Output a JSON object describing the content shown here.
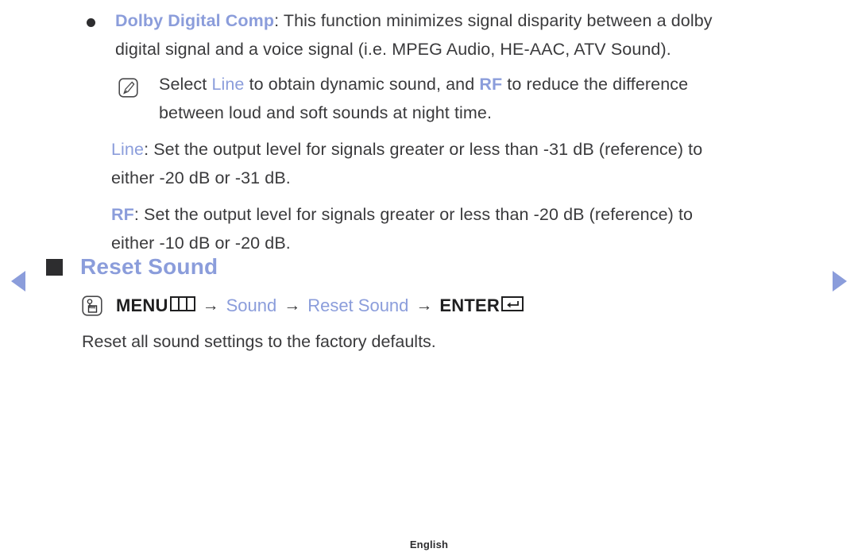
{
  "nav": {
    "prev_icon": "triangle-left-icon",
    "next_icon": "triangle-right-icon",
    "accent_color": "#8b9ddb"
  },
  "body": {
    "bullet_item": {
      "term": "Dolby Digital Comp",
      "line1_rest": ": This function minimizes signal disparity between a dolby",
      "line2": "digital signal and a voice signal (i.e. MPEG Audio, HE-AAC, ATV Sound)."
    },
    "note": {
      "icon": "note-pencil-icon",
      "text_before": "Select ",
      "keyword1": "Line",
      "text_middle": " to obtain dynamic sound, and ",
      "keyword2": "RF",
      "text_after": " to reduce the difference",
      "line2": "between loud and soft sounds at night time."
    },
    "line_def": {
      "term": "Line",
      "line1_rest": ": Set the output level for signals greater or less than -31 dB (reference) to",
      "line2": "either -20 dB or -31 dB."
    },
    "rf_def": {
      "term": "RF",
      "line1_rest": ": Set the output level for signals greater or less than -20 dB (reference) to",
      "line2": "either -10 dB or -20 dB."
    }
  },
  "section": {
    "bullet_icon": "square-bullet-icon",
    "title": "Reset Sound",
    "menu_path": {
      "touch_icon": "hand-press-icon",
      "menu_label": "MENU",
      "menu_glyph_icon": "menu-columns-icon",
      "arrow1": "→",
      "step2": "Sound",
      "arrow2": "→",
      "step3": "Reset Sound",
      "arrow3": "→",
      "enter_label": "ENTER",
      "enter_glyph_icon": "enter-return-icon"
    },
    "description": "Reset all sound settings to the factory defaults."
  },
  "footer": {
    "language": "English"
  }
}
